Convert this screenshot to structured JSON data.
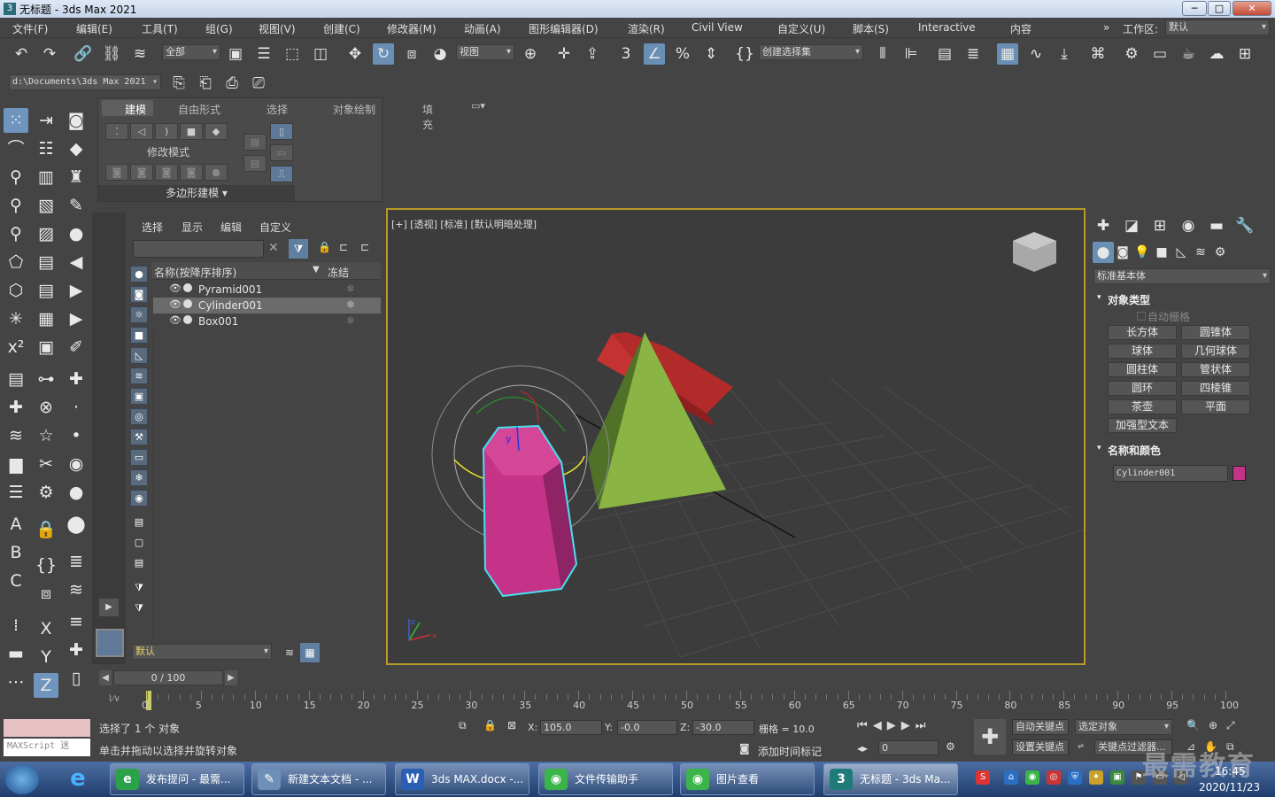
{
  "window": {
    "title": "无标题 - 3ds Max 2021",
    "app_icon": "3ds-max-icon",
    "minimize": "─",
    "maximize": "□",
    "close": "✕"
  },
  "menu": [
    "文件(F)",
    "编辑(E)",
    "工具(T)",
    "组(G)",
    "视图(V)",
    "创建(C)",
    "修改器(M)",
    "动画(A)",
    "图形编辑器(D)",
    "渲染(R)",
    "Civil View",
    "自定义(U)",
    "脚本(S)",
    "Interactive",
    "内容"
  ],
  "workspace": {
    "label": "工作区:",
    "value": "默认",
    "more": "»"
  },
  "toolbar": {
    "selection_filter": "全部",
    "ref_coord": "视图",
    "named_selection": "创建选择集"
  },
  "project_path": "d:\\Documents\\3ds Max 2021",
  "ribbon": {
    "tabs": [
      "建模",
      "自由形式",
      "选择",
      "对象绘制",
      "填充"
    ],
    "modify_mode": "修改模式",
    "poly_modeling": "多边形建模 ▾"
  },
  "scene_explorer": {
    "menu": [
      "选择",
      "显示",
      "编辑",
      "自定义"
    ],
    "search_placeholder": "",
    "col_name": "名称(按降序排序)",
    "col_freeze": "冻结",
    "sort_arrow": "▼",
    "objects": [
      {
        "name": "Pyramid001",
        "selected": false
      },
      {
        "name": "Cylinder001",
        "selected": true
      },
      {
        "name": "Box001",
        "selected": false
      }
    ],
    "layer": "默认"
  },
  "viewport": {
    "label": "[+] [透视] [标准] [默认明暗处理]",
    "axis_x": "x",
    "axis_y": "y",
    "axis_z": "z",
    "colors": {
      "box": "#b22a2a",
      "pyramid": "#8ab443",
      "cylinder": "#c43387",
      "highlight": "#48e0f0",
      "border": "#b79a2b"
    }
  },
  "command_panel": {
    "category": "标准基本体",
    "rollout_object_type": "对象类型",
    "autogrid": "自动栅格",
    "buttons": [
      "长方体",
      "圆锥体",
      "球体",
      "几何球体",
      "圆柱体",
      "管状体",
      "圆环",
      "四棱锥",
      "茶壶",
      "平面",
      "加强型文本"
    ],
    "rollout_name_color": "名称和颜色",
    "object_name": "Cylinder001",
    "object_color": "#c43388"
  },
  "timeline": {
    "frame": "0 / 100",
    "ticks": [
      "0",
      "5",
      "10",
      "15",
      "20",
      "25",
      "30",
      "35",
      "40",
      "45",
      "50",
      "55",
      "60",
      "65",
      "70",
      "75",
      "80",
      "85",
      "90",
      "95",
      "100"
    ]
  },
  "status": {
    "maxscript": "MAXScript 迷",
    "selected": "选择了 1 个 对象",
    "hint": "单击并拖动以选择并旋转对象",
    "x_label": "X:",
    "x": "105.0",
    "y_label": "Y:",
    "y": "-0.0",
    "z_label": "Z:",
    "z": "-30.0",
    "grid": "栅格 = 10.0",
    "add_time_tag": "添加时间标记",
    "auto_key": "自动关键点",
    "set_key": "设置关键点",
    "selected_object": "选定对象",
    "key_filter": "关键点过滤器...",
    "frame_field": "0"
  },
  "taskbar": {
    "tasks": [
      {
        "label": "发布提问 - 最需...",
        "icon": "360-browser-icon",
        "color": "#2aa24a",
        "glyph": "e"
      },
      {
        "label": "新建文本文档 - ...",
        "icon": "notepad-icon",
        "color": "#6d8fb8",
        "glyph": "✎"
      },
      {
        "label": "3ds MAX.docx -...",
        "icon": "word-icon",
        "color": "#2b5fb4",
        "glyph": "W"
      },
      {
        "label": "文件传输助手",
        "icon": "wechat-icon",
        "color": "#3bb54a",
        "glyph": "◉"
      },
      {
        "label": "图片查看",
        "icon": "wechat-icon",
        "color": "#3bb54a",
        "glyph": "◉"
      },
      {
        "label": "无标题 - 3ds Ma...",
        "icon": "3ds-max-icon",
        "color": "#1f7a7a",
        "glyph": "3"
      }
    ],
    "clock_time": "16:45",
    "clock_date": "2020/11/23",
    "watermark": "最需教育"
  }
}
